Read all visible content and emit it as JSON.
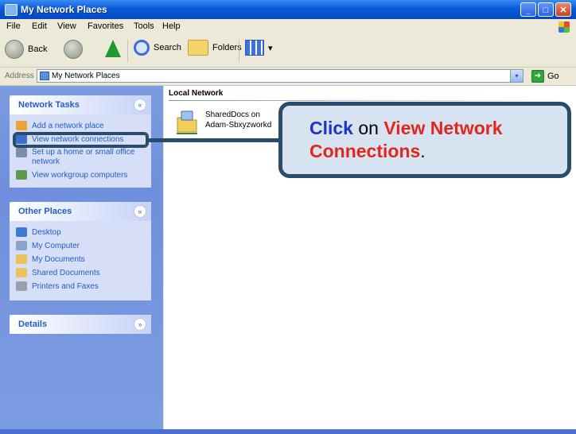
{
  "window": {
    "title": "My Network Places"
  },
  "title_buttons": {
    "minimize": "_",
    "maximize": "□",
    "close": "✕"
  },
  "menu": [
    "File",
    "Edit",
    "View",
    "Favorites",
    "Tools",
    "Help"
  ],
  "toolbar": {
    "back": "Back",
    "search": "Search",
    "folders": "Folders",
    "views_arrow": "▾"
  },
  "address": {
    "label": "Address",
    "value": "My Network Places",
    "dropdown": "▾",
    "go": "Go",
    "go_arrow": "➜"
  },
  "network_tasks": {
    "title": "Network Tasks",
    "toggle": "«",
    "items": [
      {
        "label": "Add a network place",
        "icon": "add-network-place-icon",
        "color": "#e9a33b"
      },
      {
        "label": "View network connections",
        "icon": "network-connections-icon",
        "color": "#3b6fcd"
      },
      {
        "label": "Set up a home or small office network",
        "icon": "home-network-icon",
        "color": "#7c8fa8"
      },
      {
        "label": "View workgroup computers",
        "icon": "workgroup-icon",
        "color": "#5a9a4a"
      }
    ]
  },
  "other_places": {
    "title": "Other Places",
    "toggle": "«",
    "items": [
      {
        "label": "Desktop",
        "icon": "desktop-icon",
        "color": "#3a7bd5"
      },
      {
        "label": "My Computer",
        "icon": "my-computer-icon",
        "color": "#8aa4c8"
      },
      {
        "label": "My Documents",
        "icon": "my-documents-icon",
        "color": "#e8c35a"
      },
      {
        "label": "Shared Documents",
        "icon": "shared-documents-icon",
        "color": "#e8c35a"
      },
      {
        "label": "Printers and Faxes",
        "icon": "printer-icon",
        "color": "#9aa0a8"
      }
    ]
  },
  "details": {
    "title": "Details",
    "toggle": "»"
  },
  "content": {
    "group_title": "Local Network",
    "share_name_1": "SharedDocs on",
    "share_name_2": "Adam-Sbxyzworkd"
  },
  "callout": {
    "part1": "Click",
    "part2": " on ",
    "part3": "View Network Connections",
    "part4": "."
  },
  "colors": {
    "callout_blue": "#1d33c9",
    "callout_red": "#e0261d",
    "callout_border": "#294c6b",
    "callout_bg": "#d8e3f1",
    "pane_link": "#215dc6"
  }
}
